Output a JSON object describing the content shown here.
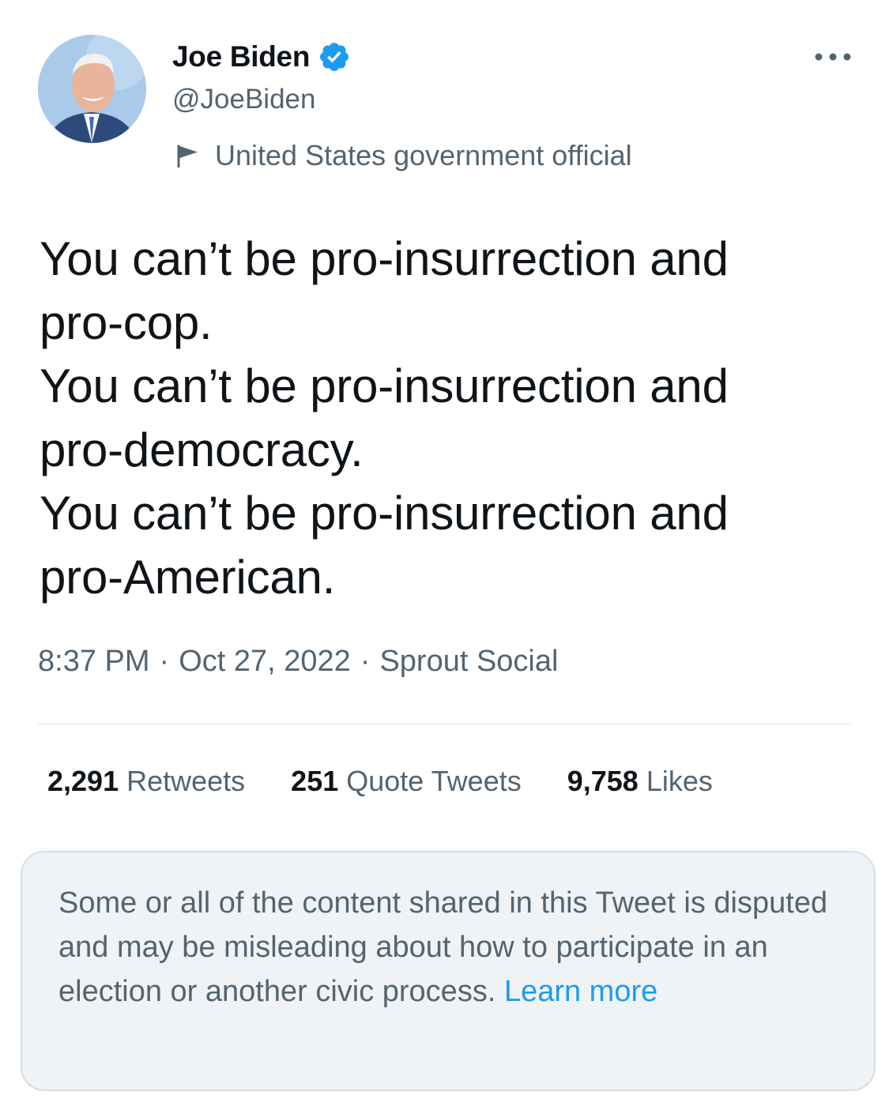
{
  "author": {
    "display_name": "Joe Biden",
    "handle": "@JoeBiden",
    "verified": true,
    "label": "United States government official",
    "avatar_icon": "profile-photo"
  },
  "tweet": {
    "lines": [
      "You can’t be pro-insurrection and",
      "pro-cop.",
      "You can’t be pro-insurrection and",
      "pro-democracy.",
      "You can’t be pro-insurrection and",
      "pro-American."
    ],
    "time": "8:37 PM",
    "separator": "·",
    "date": "Oct 27, 2022",
    "source": "Sprout Social"
  },
  "stats": [
    {
      "count": "2,291",
      "label": "Retweets"
    },
    {
      "count": "251",
      "label": "Quote Tweets"
    },
    {
      "count": "9,758",
      "label": "Likes"
    }
  ],
  "notice": {
    "text": "Some or all of the content shared in this Tweet is disputed and may be misleading about how to participate in an election or another civic process. ",
    "link": "Learn more"
  },
  "icons": {
    "verified": "verified-badge-icon",
    "label": "flag-icon",
    "menu": "more-options-icon"
  },
  "colors": {
    "primary_text": "#0f1419",
    "secondary_text": "#536471",
    "accent": "#1d9bf0",
    "notice_bg": "#f0f3f5"
  }
}
